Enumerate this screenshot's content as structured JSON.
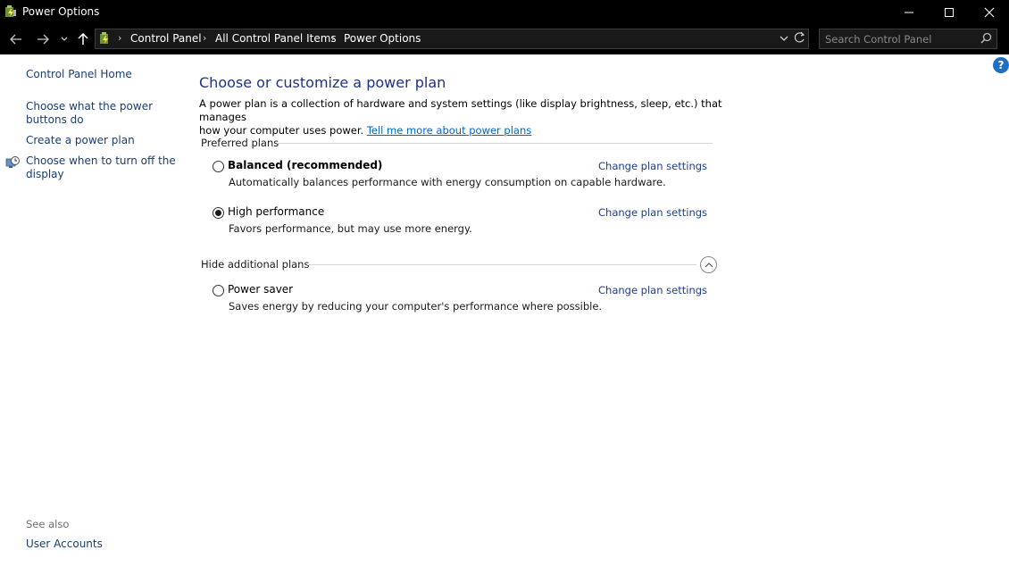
{
  "window": {
    "title": "Power Options",
    "icon": "power-options-icon"
  },
  "navigation": {
    "breadcrumbs": [
      "Control Panel",
      "All Control Panel Items",
      "Power Options"
    ],
    "search_placeholder": "Search Control Panel"
  },
  "sidebar": {
    "home_label": "Control Panel Home",
    "links": [
      {
        "label_line1": "Choose what the power",
        "label_line2": "buttons do"
      },
      {
        "label_line1": "Create a power plan"
      },
      {
        "label_line1": "Choose when to turn off the",
        "label_line2": "display",
        "icon": "clock-display-icon"
      }
    ],
    "see_also_label": "See also",
    "see_also_links": [
      "User Accounts"
    ]
  },
  "main": {
    "title": "Choose or customize a power plan",
    "description_line1": "A power plan is a collection of hardware and system settings (like display brightness, sleep, etc.) that manages",
    "description_line2_prefix": "how your computer uses power. ",
    "description_link": "Tell me more about power plans",
    "preferred_plans_header": "Preferred plans",
    "additional_plans_header": "Hide additional plans",
    "plans": [
      {
        "name": "Balanced (recommended)",
        "description": "Automatically balances performance with energy consumption on capable hardware.",
        "link": "Change plan settings",
        "selected": false
      },
      {
        "name": "High performance",
        "description": "Favors performance, but may use more energy.",
        "link": "Change plan settings",
        "selected": true
      },
      {
        "name": "Power saver",
        "description": "Saves energy by reducing your computer's performance where possible.",
        "link": "Change plan settings",
        "selected": false
      }
    ],
    "help_label": "?"
  }
}
